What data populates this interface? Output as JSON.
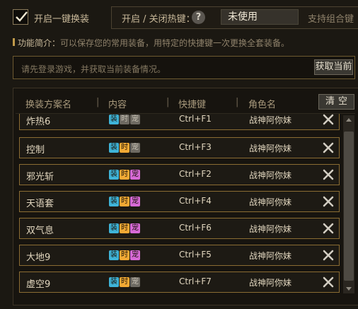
{
  "header": {
    "toggle_label": "开启一键换装",
    "toggle_checked": true,
    "hotkey_label": "开启 / 关闭热键：",
    "help_glyph": "?",
    "hotkey_value": "未使用",
    "combo_note": "支持组合键"
  },
  "intro": {
    "label": "功能简介：",
    "text": "可以保存您的常用装备，用特定的快捷键一次更换全套装备。"
  },
  "info": {
    "message": "请先登录游戏，并获取当前装备情况。",
    "fetch_label": "获取当前"
  },
  "table": {
    "columns": [
      "换装方案名",
      "内容",
      "快捷键",
      "角色名"
    ],
    "separator": "|",
    "clear_label": "清空",
    "tag_labels": [
      "装",
      "时",
      "宠"
    ],
    "tag_colors": {
      "equip_active": "#3fb4d8",
      "fashion_active": "#f2a934",
      "pet_active": "#d76ad6",
      "inactive": "#6e6a62"
    },
    "rows": [
      {
        "name": "炸热6",
        "hotkey": "Ctrl+F1",
        "role": "战神阿你妹",
        "equip": true,
        "fashion": false,
        "pet": false
      },
      {
        "name": "控制",
        "hotkey": "Ctrl+F3",
        "role": "战神阿你妹",
        "equip": true,
        "fashion": true,
        "pet": false
      },
      {
        "name": "邪光斩",
        "hotkey": "Ctrl+F2",
        "role": "战神阿你妹",
        "equip": true,
        "fashion": true,
        "pet": true
      },
      {
        "name": "天语套",
        "hotkey": "Ctrl+F4",
        "role": "战神阿你妹",
        "equip": true,
        "fashion": true,
        "pet": true
      },
      {
        "name": "双气息",
        "hotkey": "Ctrl+F6",
        "role": "战神阿你妹",
        "equip": true,
        "fashion": true,
        "pet": true
      },
      {
        "name": "大地9",
        "hotkey": "Ctrl+F5",
        "role": "战神阿你妹",
        "equip": true,
        "fashion": true,
        "pet": true
      },
      {
        "name": "虚空9",
        "hotkey": "Ctrl+F7",
        "role": "战神阿你妹",
        "equip": true,
        "fashion": true,
        "pet": false
      }
    ]
  },
  "icons": {
    "checkbox": "checkmark-icon",
    "help": "question-mark-icon",
    "delete": "close-icon",
    "scroll_up": "scroll-up-arrow-icon",
    "scroll_down": "scroll-down-arrow-icon"
  }
}
